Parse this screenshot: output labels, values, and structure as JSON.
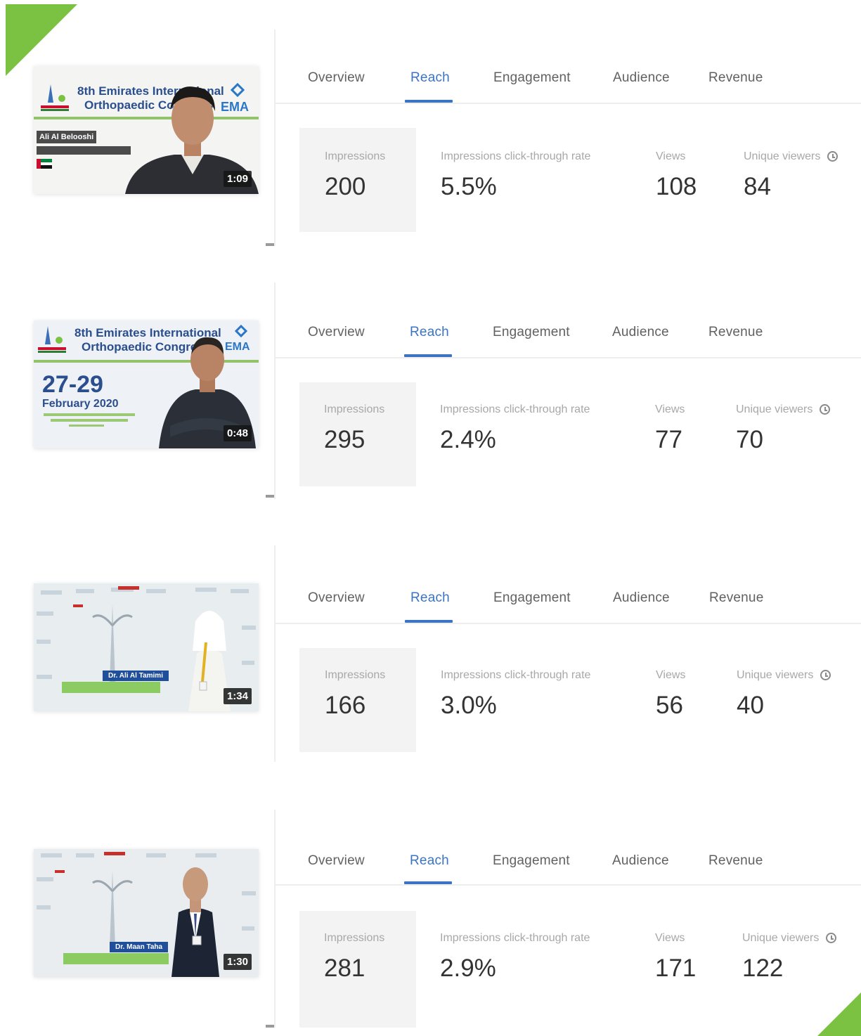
{
  "tabs": [
    "Overview",
    "Reach",
    "Engagement",
    "Audience",
    "Revenue"
  ],
  "metric_labels": {
    "impressions": "Impressions",
    "ctr": "Impressions click-through rate",
    "views": "Views",
    "unique": "Unique viewers"
  },
  "colors": {
    "accent_green": "#7bc142",
    "tab_active": "#3b74c4",
    "tab_inactive": "#616161",
    "metric_highlight_bg": "#f3f3f3"
  },
  "videos": [
    {
      "thumb_title_line1": "8th Emirates International",
      "thumb_title_line2": "Orthopaedic Congress",
      "thumb_name": "Ali Al Belooshi",
      "duration": "1:09",
      "impressions": "200",
      "ctr": "5.5%",
      "views": "108",
      "unique": "84"
    },
    {
      "thumb_title_line1": "8th Emirates International",
      "thumb_title_line2": "Orthopaedic Congress",
      "thumb_dates": "27-29",
      "thumb_month": "February 2020",
      "duration": "0:48",
      "impressions": "295",
      "ctr": "2.4%",
      "views": "77",
      "unique": "70"
    },
    {
      "thumb_name": "Dr. Ali Al Tamimi",
      "duration": "1:34",
      "impressions": "166",
      "ctr": "3.0%",
      "views": "56",
      "unique": "40"
    },
    {
      "thumb_name": "Dr. Maan Taha",
      "duration": "1:30",
      "impressions": "281",
      "ctr": "2.9%",
      "views": "171",
      "unique": "122"
    }
  ]
}
